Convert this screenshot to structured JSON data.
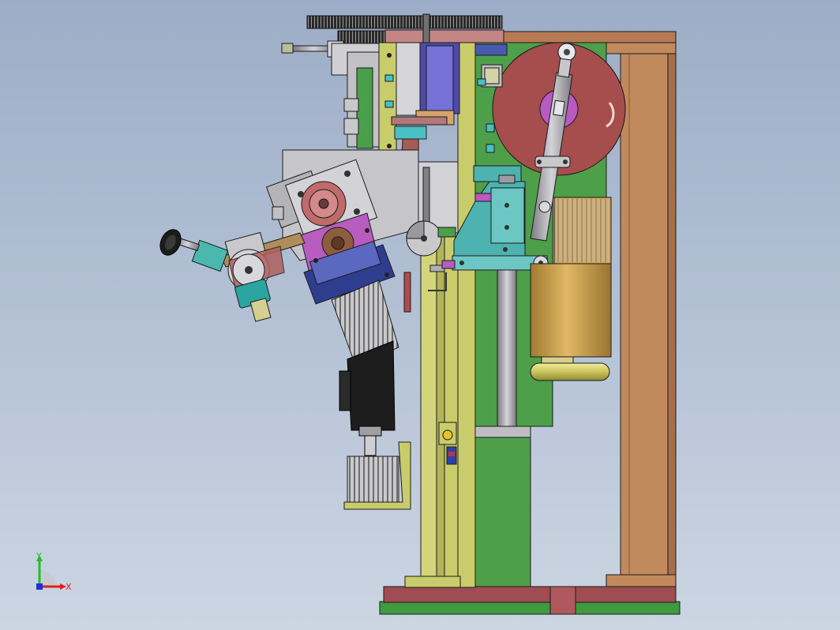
{
  "viewport": {
    "background_top": "#9dadc7",
    "background_bottom": "#ccd6e3"
  },
  "triad": {
    "x_label": "X",
    "y_label": "Y",
    "x_color": "#e0201b",
    "y_color": "#1fbf2a",
    "z_color": "#2230d8"
  },
  "palette": {
    "frame_wood": "#c08a5c",
    "frame_brown": "#b77a55",
    "plate_green": "#4e9f4a",
    "base_red": "#9f4c52",
    "rail_yellow": "#c9cc6a",
    "disc_red": "#a64d4d",
    "motor_gold": "#c19a45",
    "teal": "#4db3b0",
    "purple": "#b95cc0",
    "navy": "#2f3d8e",
    "grey": "#b9b9bd",
    "dark_motor": "#1d1d1d"
  }
}
